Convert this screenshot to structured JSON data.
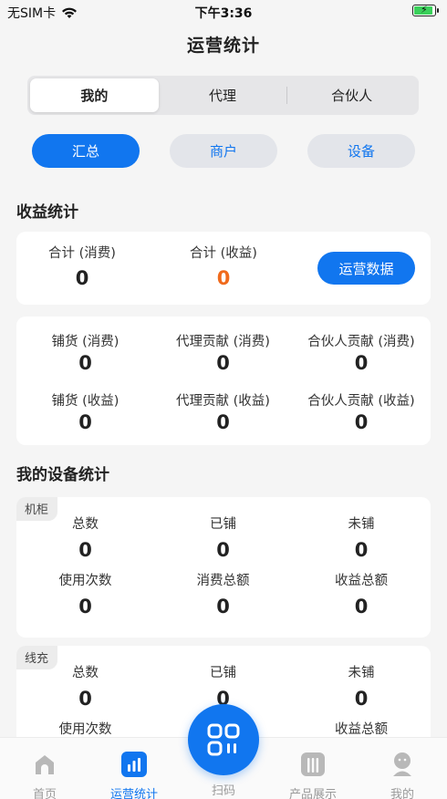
{
  "status_bar": {
    "carrier": "无SIM卡",
    "time": "下午3:36"
  },
  "page_title": "运营统计",
  "segments": [
    "我的",
    "代理",
    "合伙人"
  ],
  "filters": [
    "汇总",
    "商户",
    "设备"
  ],
  "revenue": {
    "title": "收益统计",
    "total_consumption_label": "合计 (消费)",
    "total_consumption": "0",
    "total_income_label": "合计 (收益)",
    "total_income": "0",
    "ops_button": "运营数据",
    "accent_color": "#f06a1c"
  },
  "breakdown": [
    {
      "label": "铺货 (消费)",
      "value": "0"
    },
    {
      "label": "代理贡献 (消费)",
      "value": "0"
    },
    {
      "label": "合伙人贡献 (消费)",
      "value": "0"
    },
    {
      "label": "铺货 (收益)",
      "value": "0"
    },
    {
      "label": "代理贡献 (收益)",
      "value": "0"
    },
    {
      "label": "合伙人贡献 (收益)",
      "value": "0"
    }
  ],
  "devices": {
    "title": "我的设备统计",
    "cabinet": {
      "tag": "机柜",
      "stats": [
        {
          "label": "总数",
          "value": "0"
        },
        {
          "label": "已铺",
          "value": "0"
        },
        {
          "label": "未铺",
          "value": "0"
        },
        {
          "label": "使用次数",
          "value": "0"
        },
        {
          "label": "消费总额",
          "value": "0"
        },
        {
          "label": "收益总额",
          "value": "0"
        }
      ]
    },
    "cable": {
      "tag": "线充",
      "stats": [
        {
          "label": "总数",
          "value": "0"
        },
        {
          "label": "已铺",
          "value": "0"
        },
        {
          "label": "未铺",
          "value": "0"
        },
        {
          "label": "使用次数",
          "value": ""
        },
        {
          "label": "收益总额",
          "value": ""
        }
      ]
    }
  },
  "tabbar": [
    {
      "label": "首页",
      "icon": "home-icon"
    },
    {
      "label": "运营统计",
      "icon": "stats-icon"
    },
    {
      "label": "扫码",
      "icon": "scan-icon"
    },
    {
      "label": "产品展示",
      "icon": "product-icon"
    },
    {
      "label": "我的",
      "icon": "profile-icon"
    }
  ],
  "colors": {
    "primary": "#1176ef",
    "inactive_tab": "#9a9a9a"
  }
}
